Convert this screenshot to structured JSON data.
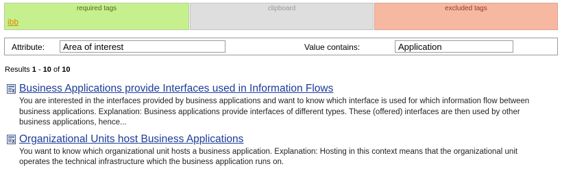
{
  "tag_boxes": {
    "required": {
      "header": "required tags",
      "tags": [
        "ibb"
      ]
    },
    "clipboard": {
      "header": "clipboard"
    },
    "excluded": {
      "header": "excluded tags"
    }
  },
  "filter": {
    "attribute_label": "Attribute:",
    "attribute_value": "Area of interest",
    "value_label": "Value contains:",
    "value_value": "Application"
  },
  "results_summary": {
    "prefix": "Results",
    "from": "1",
    "sep": "-",
    "to": "10",
    "of": "of",
    "total": "10"
  },
  "results": [
    {
      "icon": "document-icon",
      "title": "Business Applications provide Interfaces used in Information Flows",
      "snippet": "You are interested in the interfaces provided by business applications and want to know which interface is used for which information flow between business applications. Explanation: Business applications provide interfaces of different types. These (offered) interfaces are then used by other business applications, hence..."
    },
    {
      "icon": "document-icon",
      "title": "Organizational Units host Business Applications",
      "snippet": "You want to know which organizational unit hosts a business application. Explanation: Hosting in this context means that the organizational unit operates the technical infrastructure which the business application runs on."
    }
  ],
  "colors": {
    "required_bg": "#c6f08e",
    "clipboard_bg": "#dedede",
    "excluded_bg": "#f7b8a2",
    "tag_link": "#d98b00",
    "result_link": "#1a3b9a"
  }
}
